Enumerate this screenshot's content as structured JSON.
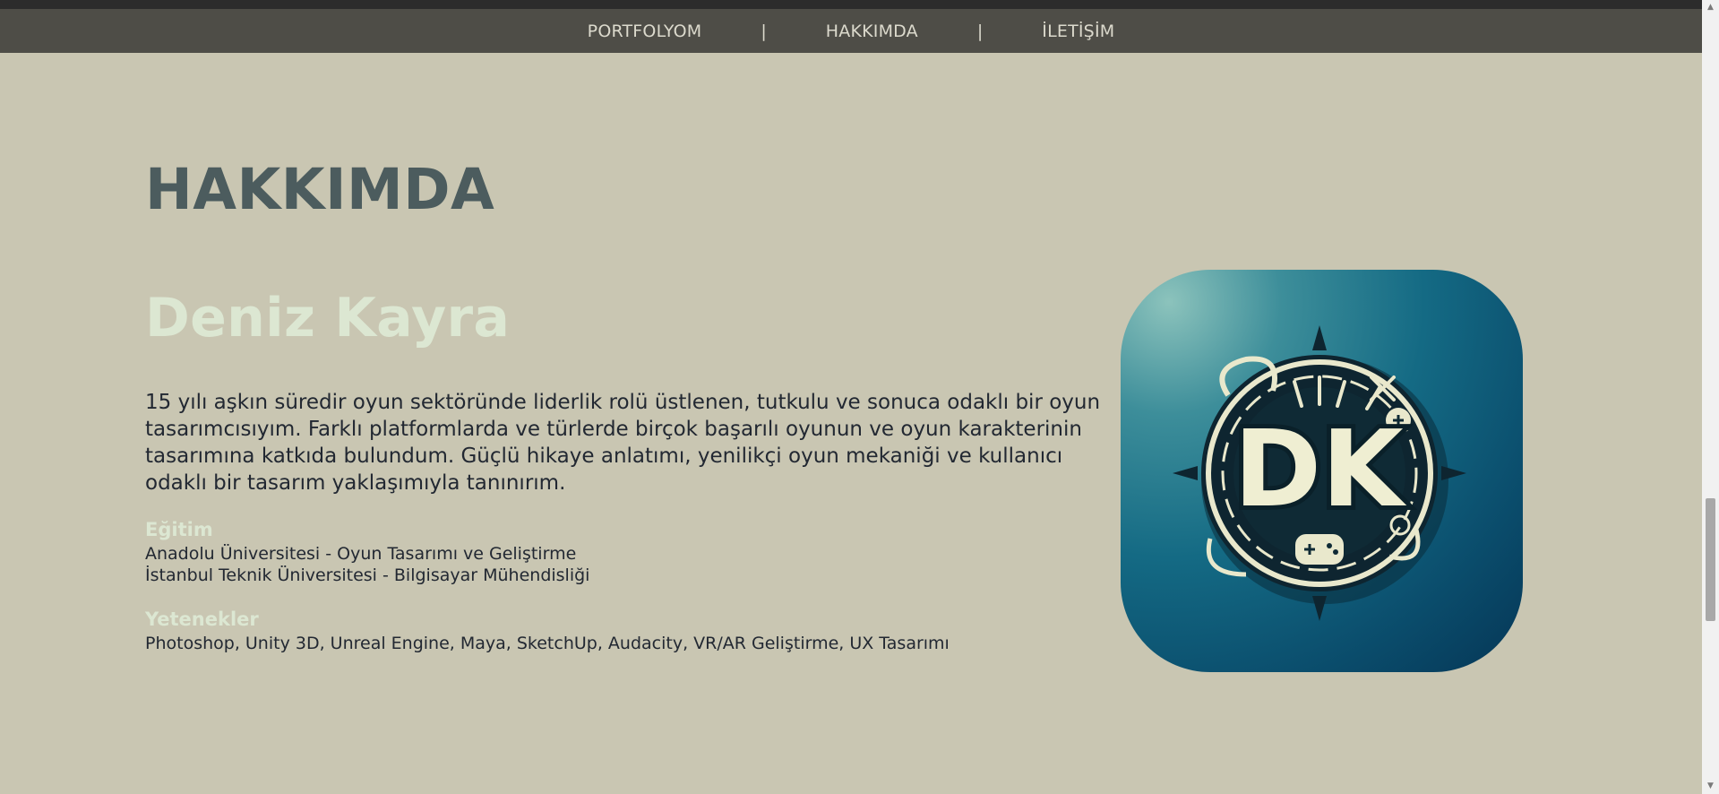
{
  "nav": {
    "items": [
      "PORTFOLYOM",
      "HAKKIMDA",
      "İLETİŞİM"
    ],
    "separator": "|"
  },
  "about": {
    "heading": "HAKKIMDA",
    "name": "Deniz Kayra",
    "bio": "15 yılı aşkın süredir oyun sektöründe liderlik rolü üstlenen, tutkulu ve sonuca odaklı bir oyun tasarımcısıyım. Farklı platformlarda ve türlerde birçok başarılı oyunun ve oyun karakterinin tasarımına katkıda bulundum. Güçlü hikaye anlatımı, yenilikçi oyun mekaniği ve kullanıcı odaklı bir tasarım yaklaşımıyla tanınırım.",
    "education": {
      "title": "Eğitim",
      "lines": [
        "Anadolu Üniversitesi - Oyun Tasarımı ve Geliştirme",
        "İstanbul Teknik Üniversitesi - Bilgisayar Mühendisliği"
      ]
    },
    "skills": {
      "title": "Yetenekler",
      "text": "Photoshop, Unity 3D, Unreal Engine, Maya, SketchUp, Audacity, VR/AR Geliştirme, UX Tasarımı"
    },
    "logo_text": "DK"
  },
  "colors": {
    "background": "#c9c6b2",
    "navbar": "#4e4d47",
    "heading": "#4c5c5e",
    "accent_light": "#dce7d2",
    "body_text": "#222832",
    "logo_gradient_dark": "#053656",
    "logo_cream": "#efeed2"
  },
  "icons": {
    "logo": "dk-emblem-icon",
    "scroll_up": "chevron-up-icon",
    "scroll_down": "chevron-down-icon"
  }
}
